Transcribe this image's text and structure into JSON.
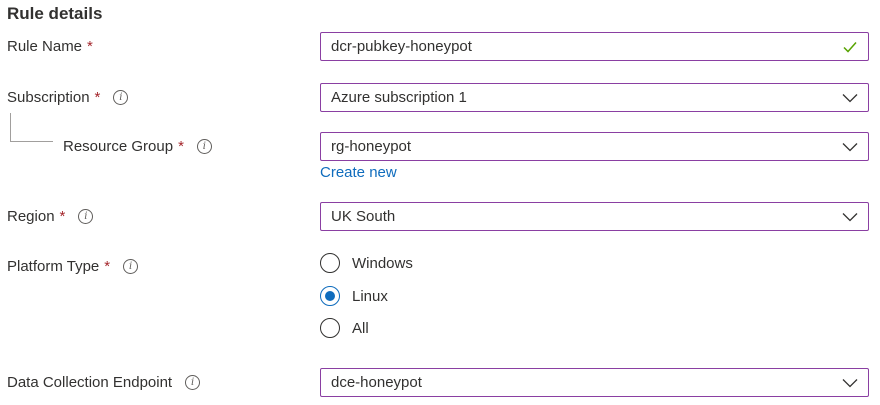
{
  "section": {
    "title": "Rule details"
  },
  "rule_name": {
    "label": "Rule Name",
    "required_mark": "*",
    "value": "dcr-pubkey-honeypot"
  },
  "subscription": {
    "label": "Subscription",
    "required_mark": "*",
    "info_glyph": "i",
    "value": "Azure subscription 1"
  },
  "resource_group": {
    "label": "Resource Group",
    "required_mark": "*",
    "info_glyph": "i",
    "value": "rg-honeypot",
    "create_new_link": "Create new"
  },
  "region": {
    "label": "Region",
    "required_mark": "*",
    "info_glyph": "i",
    "value": "UK South"
  },
  "platform_type": {
    "label": "Platform Type",
    "required_mark": "*",
    "info_glyph": "i",
    "options": [
      {
        "label": "Windows",
        "checked": false
      },
      {
        "label": "Linux",
        "checked": true
      },
      {
        "label": "All",
        "checked": false
      }
    ]
  },
  "data_collection_endpoint": {
    "label": "Data Collection Endpoint",
    "info_glyph": "i",
    "value": "dce-honeypot"
  },
  "colors": {
    "field_border": "#8a3fa2",
    "required": "#a4262c",
    "link": "#0f6cbd",
    "valid_check": "#57a300",
    "radio_checked": "#0f6cbd"
  },
  "icons": [
    "checkmark-icon",
    "chevron-down-icon",
    "info-icon"
  ]
}
